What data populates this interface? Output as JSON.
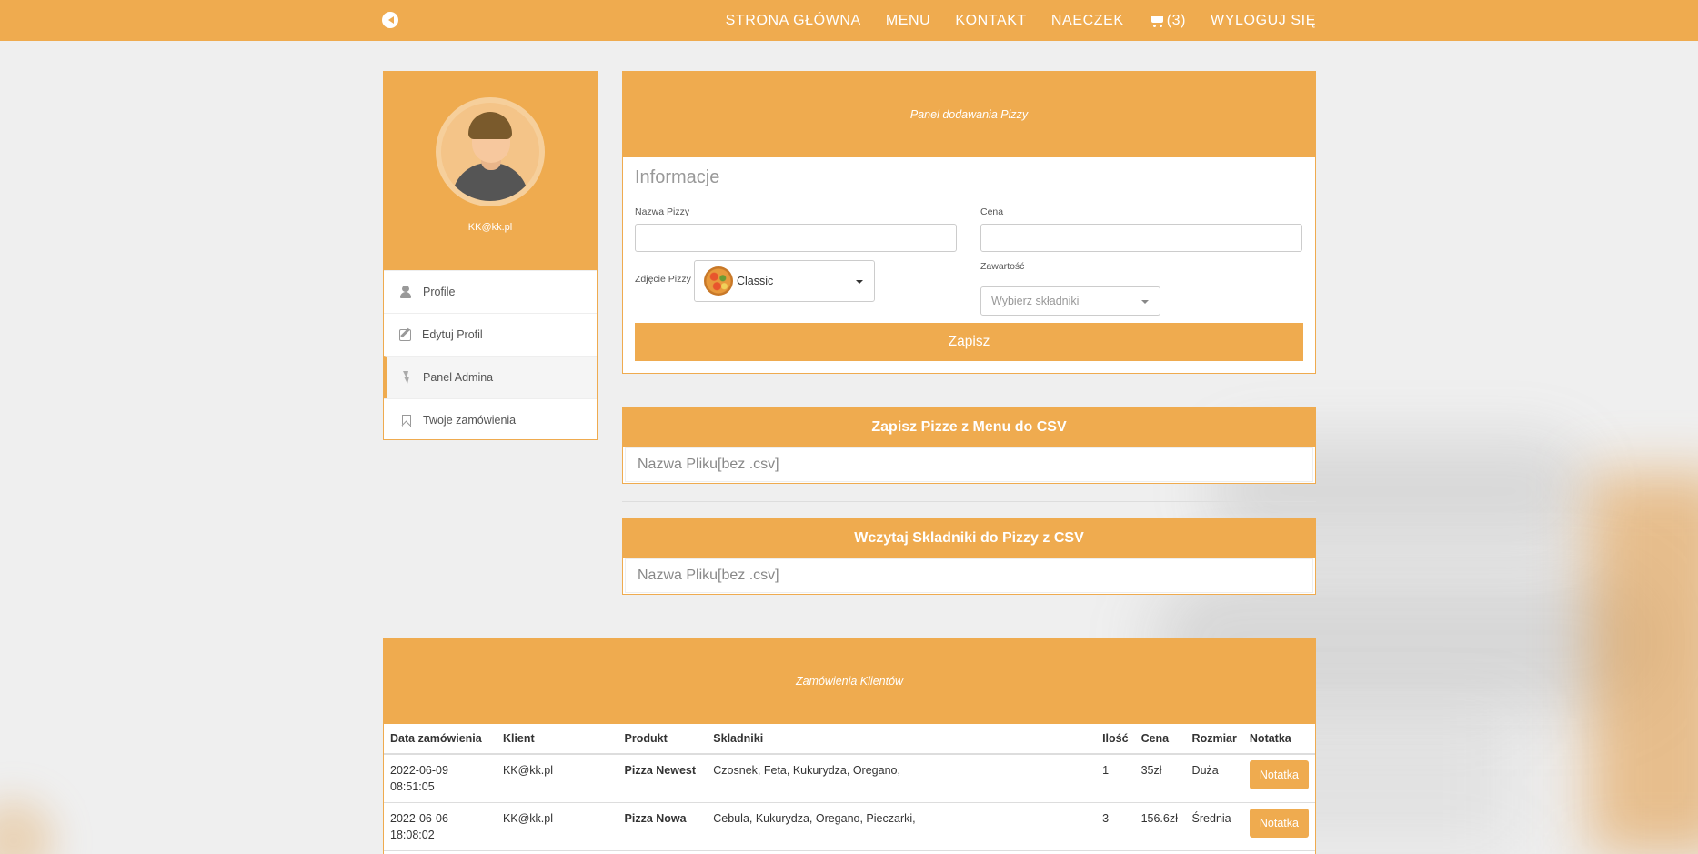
{
  "colors": {
    "accent": "#efab4f",
    "background": "#efefef"
  },
  "navbar": {
    "links": [
      "STRONA GŁÓWNA",
      "MENU",
      "KONTAKT",
      "NAECZEK"
    ],
    "cart_count": "(3)",
    "logout": "WYLOGUJ SIĘ"
  },
  "profile": {
    "email": "KK@kk.pl",
    "menu": [
      {
        "label": "Profile",
        "icon": "user-icon"
      },
      {
        "label": "Edytuj Profil",
        "icon": "edit-icon"
      },
      {
        "label": "Panel Admina",
        "icon": "bolt-icon",
        "active": true
      },
      {
        "label": "Twoje zamówienia",
        "icon": "bookmark-icon"
      }
    ]
  },
  "pizza_form": {
    "banner": "Panel dodawania Pizzy",
    "section_title": "Informacje",
    "name_label": "Nazwa Pizzy",
    "name_value": "",
    "price_label": "Cena",
    "price_value": "",
    "image_label": "Zdjęcie Pizzy",
    "image_selected": "Classic",
    "contents_label": "Zawartość",
    "contents_placeholder": "Wybierz składniki",
    "save_label": "Zapisz"
  },
  "csv_export": {
    "title": "Zapisz Pizze z Menu do CSV",
    "placeholder": "Nazwa Pliku[bez .csv]"
  },
  "csv_import": {
    "title": "Wczytaj Skladniki do Pizzy z CSV",
    "placeholder": "Nazwa Pliku[bez .csv]"
  },
  "orders": {
    "banner": "Zamówienia Klientów",
    "columns": [
      "Data zamówienia",
      "Klient",
      "Produkt",
      "Skladniki",
      "Ilość",
      "Cena",
      "Rozmiar",
      "Notatka"
    ],
    "rows": [
      {
        "date": "2022-06-09",
        "time": "08:51:05",
        "client": "KK@kk.pl",
        "product": "Pizza Newest",
        "ingredients": "Czosnek, Feta, Kukurydza, Oregano,",
        "qty": "1",
        "price": "35zł",
        "size": "Duża",
        "note": "Notatka"
      },
      {
        "date": "2022-06-06",
        "time": "18:08:02",
        "client": "KK@kk.pl",
        "product": "Pizza Nowa",
        "ingredients": "Cebula, Kukurydza, Oregano, Pieczarki,",
        "qty": "3",
        "price": "156.6zł",
        "size": "Średnia",
        "note": "Notatka"
      }
    ]
  }
}
